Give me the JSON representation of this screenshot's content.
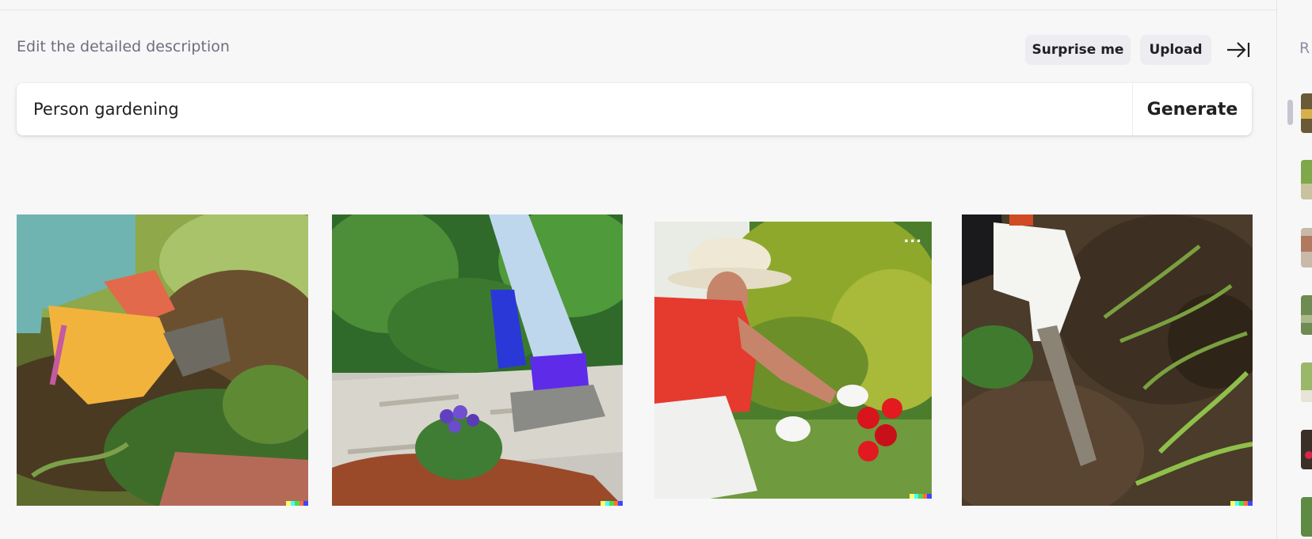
{
  "header": {
    "description_label": "Edit the detailed description",
    "surprise_label": "Surprise me",
    "upload_label": "Upload"
  },
  "prompt": {
    "value": "Person gardening",
    "generate_label": "Generate"
  },
  "images": [
    {
      "name": "gloved-hands-pulling-weeds"
    },
    {
      "name": "kneeling-gardener-planting-purple-flowers"
    },
    {
      "name": "woman-in-hat-tending-red-flowers",
      "menu": "..."
    },
    {
      "name": "gloved-hand-with-trowel-in-soil"
    }
  ],
  "sidebar": {
    "title_initial": "R",
    "thumbnail_count": 7
  },
  "colors": {
    "background": "#f7f7f8",
    "pill": "#ececf1",
    "text": "#202123",
    "muted": "#6e6e80",
    "badge": [
      "#ffff66",
      "#42ffff",
      "#51da4c",
      "#ff6e3c",
      "#3c46ff"
    ]
  }
}
